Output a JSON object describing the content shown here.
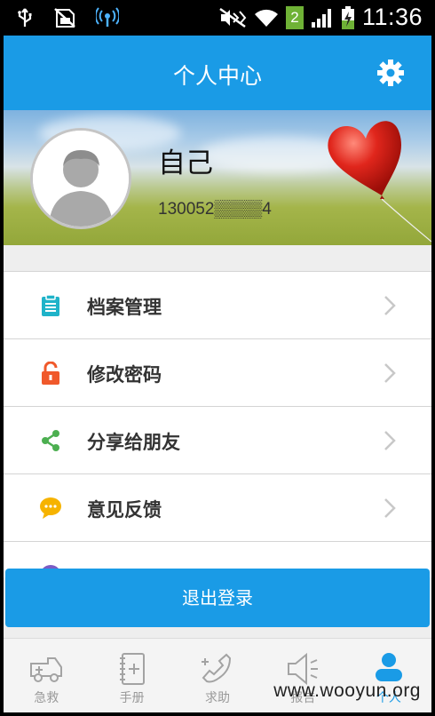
{
  "status_bar": {
    "time": "11:36",
    "sim_slot": "2",
    "icons": [
      "usb-icon",
      "no-sim-icon",
      "hotspot-icon",
      "mute-icon",
      "wifi-icon",
      "signal-icon",
      "battery-charging-icon"
    ]
  },
  "header": {
    "title": "个人中心",
    "settings_icon": "gear-icon"
  },
  "profile": {
    "name": "自己",
    "phone": "130052▒▒▒▒4"
  },
  "menu": {
    "items": [
      {
        "label": "档案管理",
        "icon": "clipboard-icon",
        "color": "#1fb3c9"
      },
      {
        "label": "修改密码",
        "icon": "lock-icon",
        "color": "#f0592b"
      },
      {
        "label": "分享给朋友",
        "icon": "share-icon",
        "color": "#4caf50"
      },
      {
        "label": "意见反馈",
        "icon": "chat-icon",
        "color": "#f6b300"
      }
    ],
    "partial_item_icon_color": "#7b5cc5"
  },
  "logout_button": {
    "label": "退出登录"
  },
  "tabs": [
    {
      "label": "急救",
      "icon": "ambulance-icon"
    },
    {
      "label": "手册",
      "icon": "handbook-icon"
    },
    {
      "label": "求助",
      "icon": "phone-help-icon"
    },
    {
      "label": "报告",
      "icon": "speaker-icon"
    },
    {
      "label": "个人",
      "icon": "person-icon",
      "active": true
    }
  ],
  "watermark": "www.wooyun.org",
  "colors": {
    "accent": "#1a9be6"
  }
}
